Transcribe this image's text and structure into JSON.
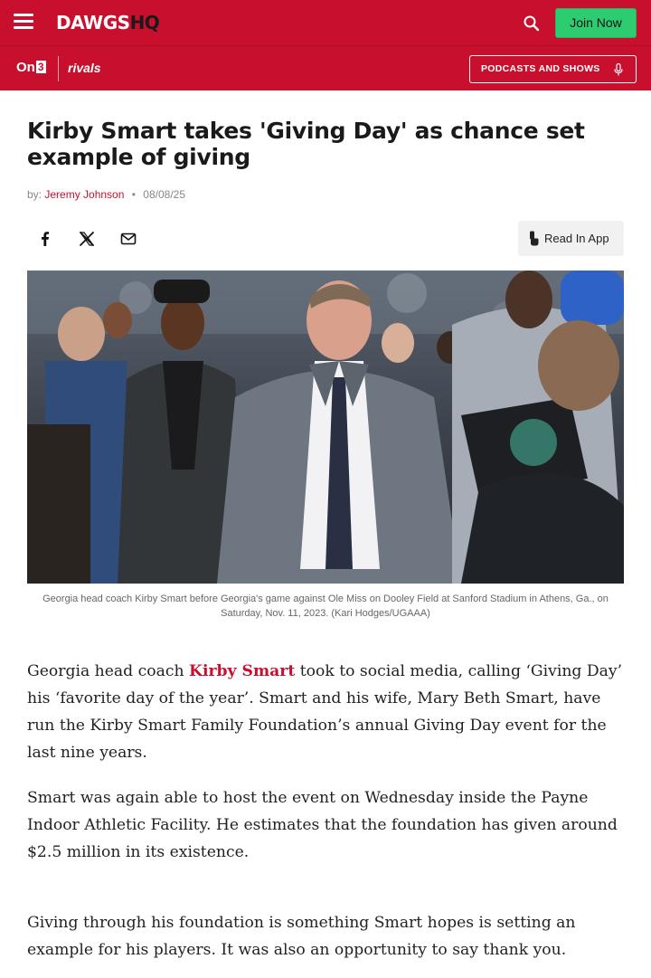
{
  "header": {
    "logo_main": "DAWGS",
    "logo_hq": "HQ",
    "join_label": "Join Now"
  },
  "subnav": {
    "on3": "On",
    "on3_num": "3",
    "rivals": "rivals",
    "podcasts_label": "PODCASTS AND SHOWS"
  },
  "article": {
    "headline": "Kirby Smart takes 'Giving Day' as chance set example of giving",
    "byline_prefix": "by:",
    "author": "Jeremy Johnson",
    "date": "08/08/25",
    "read_in_app": "Read In App",
    "caption": "Georgia head coach Kirby Smart before Georgia's game against Ole Miss on Dooley Field at Sanford Stadium in Athens, Ga., on Saturday, Nov. 11, 2023. (Kari Hodges/UGAAA)",
    "p1_before": "Georgia head coach ",
    "p1_link": "Kirby Smart",
    "p1_after": " took to social media, calling ‘Giving Day’ his ‘favorite day of the year’. Smart and his wife, Mary Beth Smart, have run the Kirby Smart Family Foundation’s annual Giving Day event for the last nine years.",
    "p2": "Smart was again able to host the event on Wednesday inside the Payne Indoor Athletic Facility. He estimates that the foundation has given around $2.5 million in its existence.",
    "p3": "Giving through his foundation is something Smart hopes is setting an example for his players. It was also an opportunity to say thank you."
  },
  "icons": [
    "menu-icon",
    "search-icon",
    "mic-icon",
    "facebook-icon",
    "x-icon",
    "email-icon",
    "phone-tap-icon"
  ],
  "colors": {
    "brand_red": "#c8102e",
    "join_green": "#2ecc71"
  }
}
